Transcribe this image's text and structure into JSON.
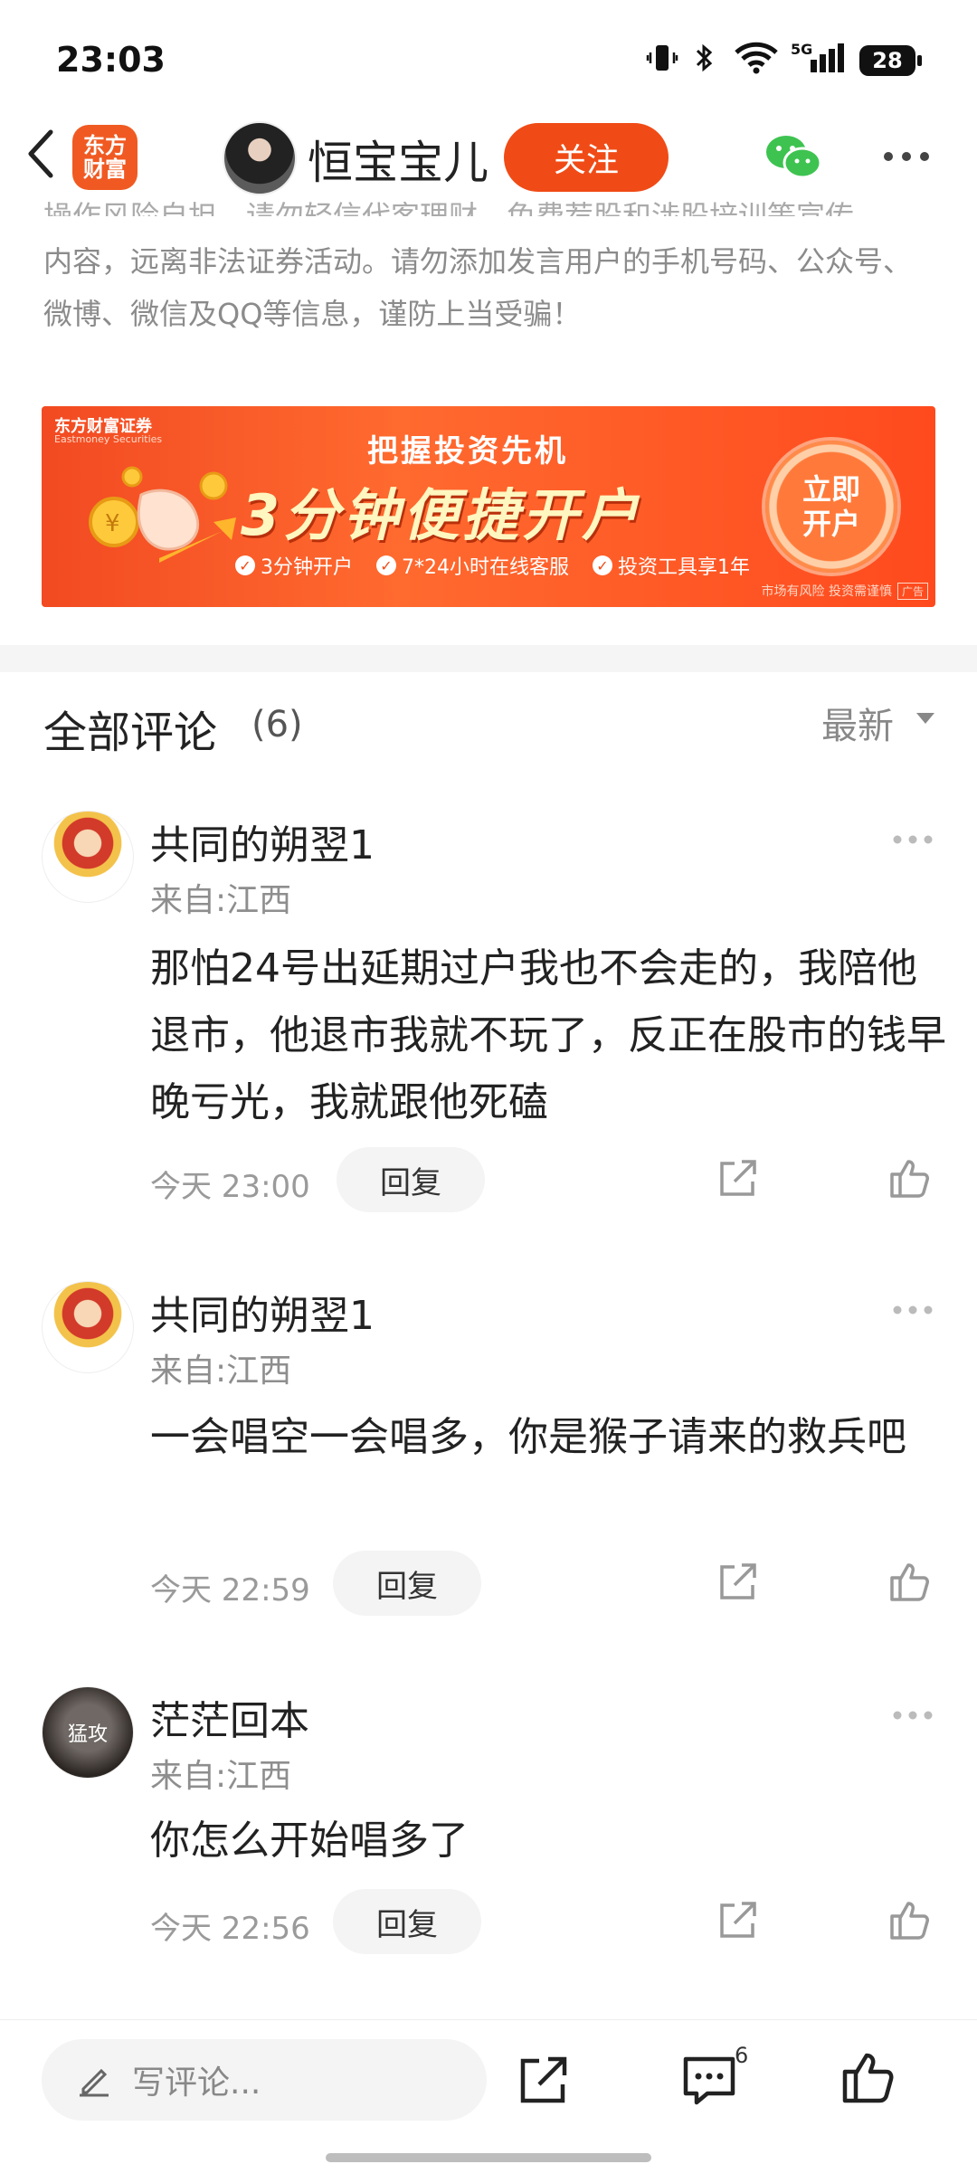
{
  "status_bar": {
    "time": "23:03",
    "battery": "28"
  },
  "header": {
    "app_logo_line1": "东方",
    "app_logo_line2": "财富",
    "author_name": "恒宝宝儿",
    "follow_label": "关注"
  },
  "warning": {
    "partial_line": "操作风险自担。请勿轻信代客理财、免费荐股和涉股培训等宣传",
    "text": "内容，远离非法证券活动。请勿添加发言用户的手机号码、公众号、微博、微信及QQ等信息，谨防上当受骗！"
  },
  "ad": {
    "brand": "东方财富证券",
    "brand_en": "Eastmoney Securities",
    "subtitle": "把握投资先机",
    "headline": "3分钟便捷开户",
    "features": [
      "3分钟开户",
      "7*24小时在线客服",
      "投资工具享1年"
    ],
    "cta_line1": "立即",
    "cta_line2": "开户",
    "risk_note": "市场有风险 投资需谨慎",
    "badge": "广告"
  },
  "comments_section": {
    "title": "全部评论",
    "count": "(6)",
    "sort_label": "最新"
  },
  "comments": [
    {
      "name": "共同的朔翌1",
      "location": "来自:江西",
      "body": "那怕24号出延期过户我也不会走的，我陪他退市，他退市我就不玩了，反正在股市的钱早晚亏光，我就跟他死磕",
      "time": "今天 23:00",
      "reply_label": "回复"
    },
    {
      "name": "共同的朔翌1",
      "location": "来自:江西",
      "body": "一会唱空一会唱多，你是猴子请来的救兵吧",
      "time": "今天 22:59",
      "reply_label": "回复"
    },
    {
      "name": "茫茫回本",
      "avatar_text": "猛攻",
      "location": "来自:江西",
      "body": "你怎么开始唱多了",
      "time": "今天 22:56",
      "reply_label": "回复"
    }
  ],
  "bottom_bar": {
    "input_placeholder": "写评论...",
    "comment_count": "6"
  },
  "colors": {
    "accent": "#f04b16",
    "text_primary": "#222222",
    "text_secondary": "#8e8e8e"
  }
}
